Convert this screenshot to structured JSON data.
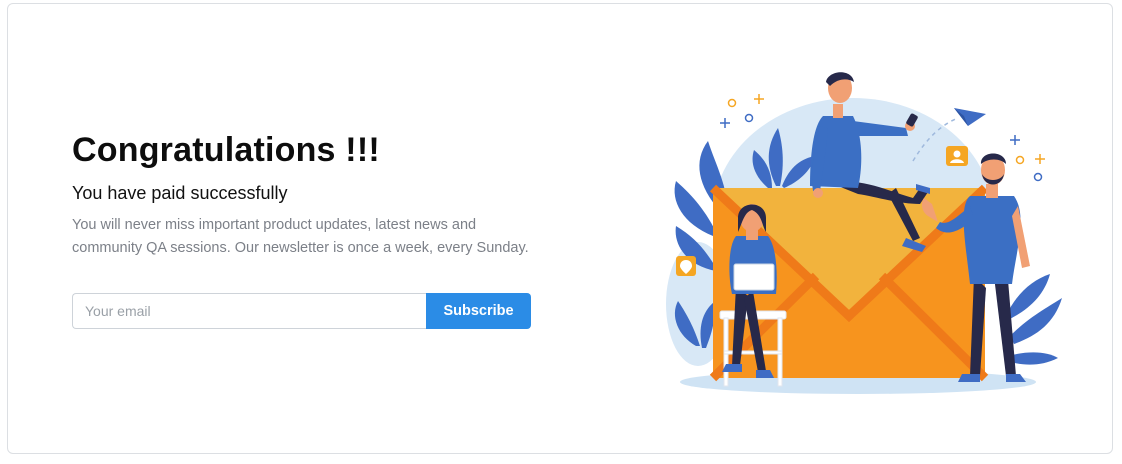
{
  "hero": {
    "title": "Congratulations !!!",
    "subtitle": "You have paid successfully",
    "description": "You will never miss important product updates, latest news and community QA sessions. Our newsletter is once a week, every Sunday."
  },
  "newsletter": {
    "email_placeholder": "Your email",
    "email_value": "",
    "subscribe_label": "Subscribe"
  },
  "illustration": {
    "subject": "newsletter-envelope-people",
    "colors": {
      "envelope": "#f7941e",
      "envelope_flap": "#f2b33d",
      "shirt_blue": "#3b6fc4",
      "pants_navy": "#27294a",
      "background_blob": "#d8e8f6",
      "accent_orange": "#f5a623",
      "button_blue": "#2b8ce6"
    }
  }
}
